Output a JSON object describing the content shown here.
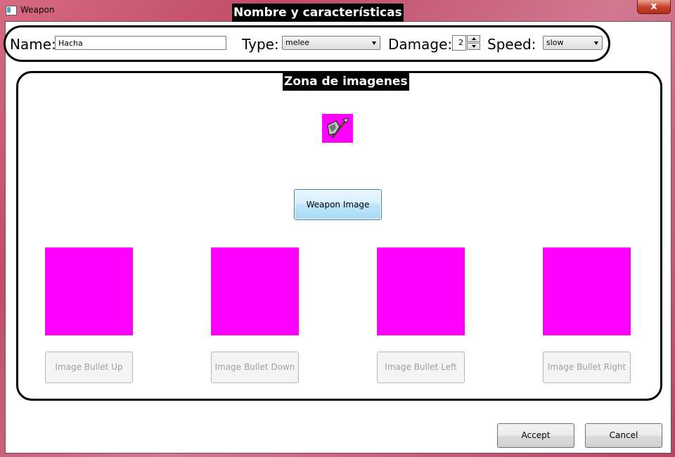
{
  "window": {
    "title": "Weapon",
    "close_glyph": "x"
  },
  "annotations": {
    "top_section": "Nombre y características",
    "image_section": "Zona de imagenes"
  },
  "fields": {
    "name_label": "Name:",
    "name_value": "Hacha",
    "type_label": "Type:",
    "type_value": "melee",
    "damage_label": "Damage:",
    "damage_value": "2",
    "speed_label": "Speed:",
    "speed_value": "slow"
  },
  "images": {
    "weapon_icon": "axe-icon",
    "weapon_button": "Weapon Image",
    "bullet_buttons": [
      "Image Bullet Up",
      "Image Bullet Down",
      "Image Bullet Left",
      "Image Bullet Right"
    ]
  },
  "dialog": {
    "accept": "Accept",
    "cancel": "Cancel"
  },
  "colors": {
    "placeholder_magenta": "#ff00ff",
    "frame": "#c04c68"
  }
}
